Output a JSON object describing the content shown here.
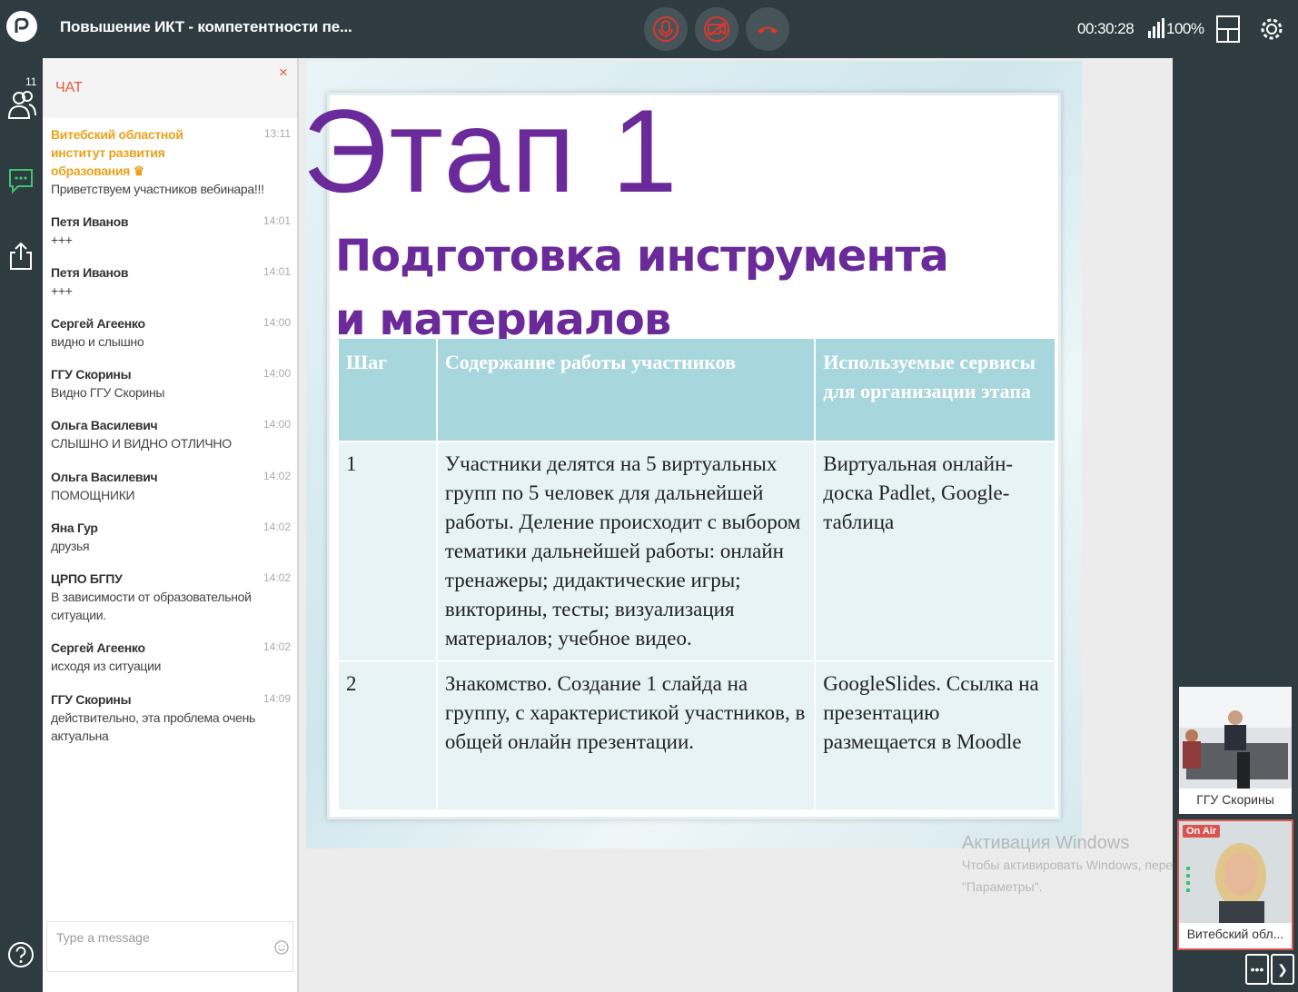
{
  "header": {
    "title": "Повышение ИКТ - компетентности пе...",
    "timer": "00:30:28",
    "signal_percent": "100%"
  },
  "colors": {
    "topbar": "#2e3b40",
    "accent": "#e05a37",
    "host": "#e8a21a",
    "slide_title": "#6a2a9a"
  },
  "rail": {
    "participants_count": "11"
  },
  "chat": {
    "title": "ЧАТ",
    "close": "×",
    "input_placeholder": "Type a message",
    "messages": [
      {
        "name": "Витебский областной институт развития образования",
        "time": "13:11",
        "text": "Приветствуем участников вебинара!!!",
        "host": true
      },
      {
        "name": "Петя Иванов",
        "time": "14:01",
        "text": "+++"
      },
      {
        "name": "Петя Иванов",
        "time": "14:01",
        "text": "+++"
      },
      {
        "name": "Сергей Агеенко",
        "time": "14:00",
        "text": "видно и слышно"
      },
      {
        "name": "ГГУ Скорины",
        "time": "14:00",
        "text": "Видно ГГУ Скорины"
      },
      {
        "name": "Ольга Василевич",
        "time": "14:00",
        "text": "СЛЫШНО И ВИДНО ОТЛИЧНО"
      },
      {
        "name": "Ольга Василевич",
        "time": "14:02",
        "text": "ПОМОЩНИКИ"
      },
      {
        "name": "Яна Гур",
        "time": "14:02",
        "text": "друзья"
      },
      {
        "name": "ЦРПО БГПУ",
        "time": "14:02",
        "text": "В зависимости от образовательной ситуации."
      },
      {
        "name": "Сергей Агеенко",
        "time": "14:02",
        "text": "исходя из ситуации"
      },
      {
        "name": "ГГУ Скорины",
        "time": "14:09",
        "text": "действительно, эта проблема очень актуальна"
      }
    ]
  },
  "slide": {
    "heading": "Этап 1",
    "subtitle": "Подготовка инструмента и материалов",
    "table": {
      "headers": [
        "Шаг",
        "Содержание работы участников",
        "Используемые сервисы для организации этапа"
      ],
      "rows": [
        [
          "1",
          "Участники делятся на 5 виртуальных групп по 5 человек для дальнейшей работы. Деление происходит с выбором тематики дальнейшей работы: онлайн тренажеры; дидактические игры; викторины, тесты; визуализация материалов; учебное видео.",
          "Виртуальная онлайн-доска Padlet, Google-таблица"
        ],
        [
          "2",
          "Знакомство. Создание 1 слайда на группу, с характеристикой участников, в общей онлайн презентации.",
          "GoogleSlides. Ссылка на презентацию размещается в Moodle"
        ]
      ]
    }
  },
  "participants": [
    {
      "caption": "ГГУ Скорины"
    },
    {
      "caption": "Витебский обл...",
      "badge": "On Air"
    }
  ],
  "watermark": {
    "line1": "Активация Windows",
    "line2": "Чтобы активировать Windows, перейдите в раздел",
    "line3": "\"Параметры\"."
  }
}
